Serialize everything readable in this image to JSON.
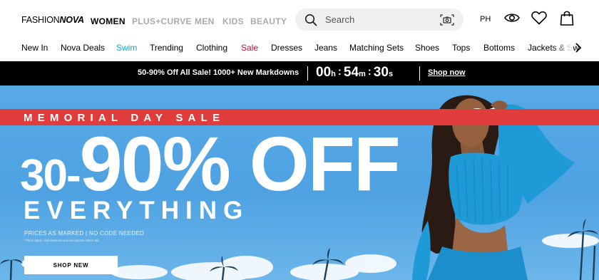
{
  "brand": {
    "logo_part1": "FASHION",
    "logo_part2": "NOVA"
  },
  "departments": [
    "WOMEN",
    "PLUS+CURVE",
    "MEN",
    "KIDS",
    "BEAUTY"
  ],
  "search": {
    "placeholder": "Search"
  },
  "country_code": "PH",
  "icons": {
    "search": "search-icon",
    "camera": "camera-search-icon",
    "eye": "eye-icon",
    "heart": "heart-icon",
    "bag": "shopping-bag-icon",
    "next": "chevron-right-icon"
  },
  "categories": [
    "New In",
    "Nova Deals",
    "Swim",
    "Trending",
    "Clothing",
    "Sale",
    "Dresses",
    "Jeans",
    "Matching Sets",
    "Shoes",
    "Tops",
    "Bottoms",
    "Jackets & Sw"
  ],
  "promo": {
    "text": "50-90% Off All Sale! 1000+ New Markdowns",
    "timer": {
      "hours": "00",
      "hours_unit": "h",
      "minutes": "54",
      "minutes_unit": "m",
      "seconds": "30",
      "seconds_unit": "s",
      "separator": ":"
    },
    "cta": "Shop now"
  },
  "hero": {
    "sale_title": "MEMORIAL DAY SALE",
    "headline_part1": "30-",
    "headline_part2": "90% OFF",
    "subheadline": "EVERYTHING",
    "note": "PRICES AS MARKED | NO CODE NEEDED",
    "fine_print": "*T&Cs apply. Visit fashionnova.com promo T&Cs tab.",
    "cta": "SHOP NEW"
  },
  "colors": {
    "accent_swim": "#1aa3c9",
    "accent_sale": "#c8102e",
    "promo_bg": "#000000",
    "hero_sky": "#4ea2e2",
    "hero_stripe": "#e03c3c",
    "outfit": "#1e9ad6"
  }
}
